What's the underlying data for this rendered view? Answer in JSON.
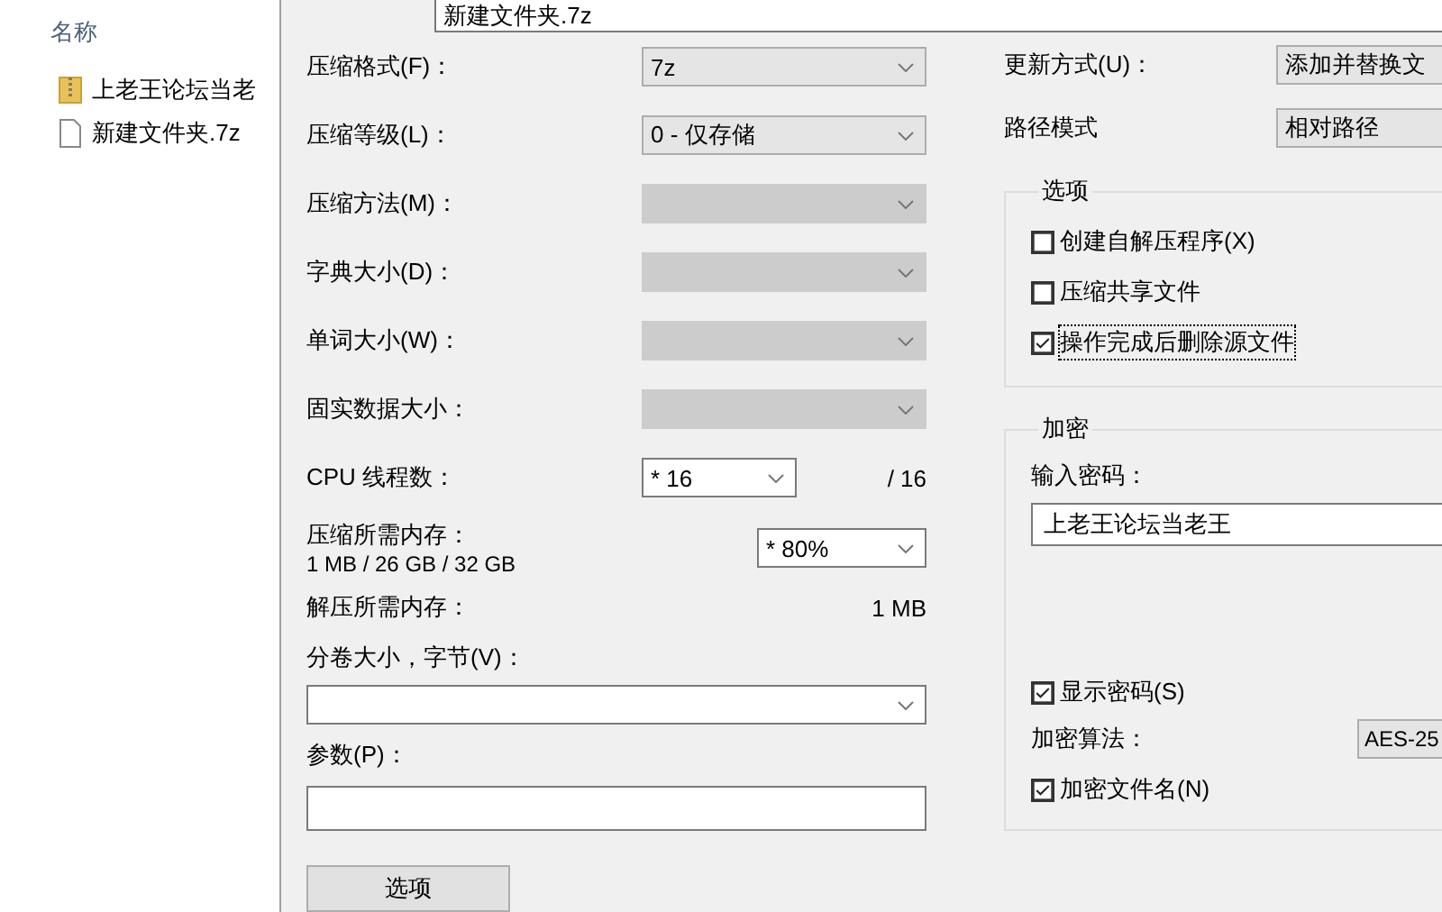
{
  "explorer": {
    "header": "名称",
    "files": [
      {
        "name": "上老王论坛当老",
        "kind": "archive"
      },
      {
        "name": "新建文件夹.7z",
        "kind": "file"
      }
    ]
  },
  "archive_field": {
    "value": "新建文件夹.7z"
  },
  "settings": [
    {
      "label": "压缩格式(F)：",
      "value": "7z",
      "disabled": false
    },
    {
      "label": "压缩等级(L)：",
      "value": "0 - 仅存储",
      "disabled": false
    },
    {
      "label": "压缩方法(M)：",
      "disabled": true
    },
    {
      "label": "字典大小(D)：",
      "disabled": true
    },
    {
      "label": "单词大小(W)：",
      "disabled": true
    },
    {
      "label": "固实数据大小：",
      "disabled": true
    }
  ],
  "cpu_threads": {
    "label": "CPU 线程数：",
    "value": "* 16",
    "total": "/ 16"
  },
  "compress_memory": {
    "label": "压缩所需内存：",
    "detail": "1 MB / 26 GB / 32 GB",
    "value": "* 80%"
  },
  "decompress_memory": {
    "label": "解压所需内存：",
    "value": "1 MB"
  },
  "volume_size": {
    "label": "分卷大小，字节(V)："
  },
  "parameters": {
    "label": "参数(P)："
  },
  "options_button": "选项",
  "update_mode": {
    "label": "更新方式(U)：",
    "value": "添加并替换文"
  },
  "path_mode": {
    "label": "路径模式",
    "value": "相对路径"
  },
  "options": {
    "title": "选项",
    "checkboxes": [
      {
        "label": "创建自解压程序(X)",
        "checked": false,
        "focused": false
      },
      {
        "label": "压缩共享文件",
        "checked": false,
        "focused": false
      },
      {
        "label": "操作完成后删除源文件",
        "checked": true,
        "focused": true
      }
    ]
  },
  "encryption": {
    "title": "加密",
    "password_label": "输入密码：",
    "password_value": "上老王论坛当老王",
    "show_password": {
      "label": "显示密码(S)",
      "checked": true
    },
    "method_label": "加密算法：",
    "method_value": "AES-25",
    "encrypt_names": {
      "label": "加密文件名(N)",
      "checked": true
    }
  }
}
